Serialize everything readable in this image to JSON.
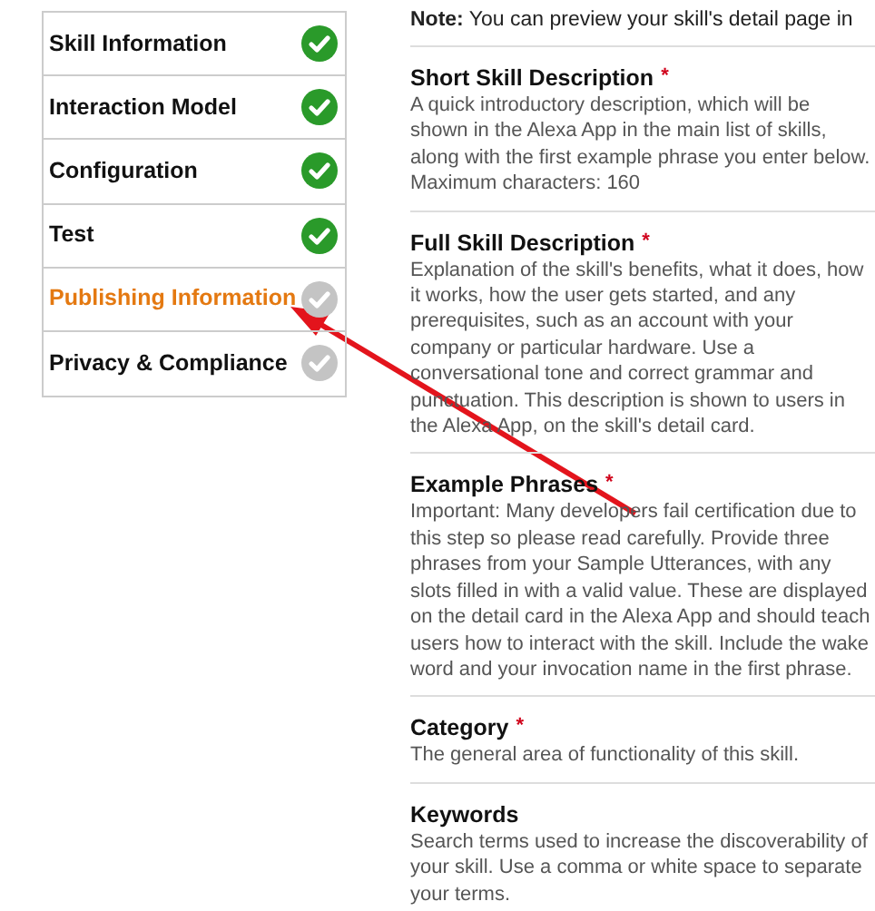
{
  "steps": [
    {
      "label": "Skill Information",
      "complete": true,
      "selected": false
    },
    {
      "label": "Interaction Model",
      "complete": true,
      "selected": false
    },
    {
      "label": "Configuration",
      "complete": true,
      "selected": false
    },
    {
      "label": "Test",
      "complete": true,
      "selected": false
    },
    {
      "label": "Publishing Information",
      "complete": false,
      "selected": true
    },
    {
      "label": "Privacy & Compliance",
      "complete": false,
      "selected": false
    }
  ],
  "note": "**Note:** You can preview your skill's detail page in",
  "fields": [
    {
      "title": "Short Skill Description",
      "required_mark": "*",
      "description": "A quick introductory description, which will be shown in the Alexa App in the main list of skills, along with the first example phrase you enter below. Maximum characters: 160"
    },
    {
      "title": "Full Skill Description",
      "required_mark": "*",
      "description": "Explanation of the skill's benefits, what it does, how it works, how the user gets started, and any prerequisites, such as an account with your company or particular hardware. Use a conversational tone and correct grammar and punctuation. This description is shown to users in the Alexa App, on the skill's detail card."
    },
    {
      "title": "Example Phrases",
      "required_mark": "*",
      "description": "Important: Many developers fail certification due to this step so please read carefully. Provide three phrases from your Sample Utterances, with any slots filled in with a valid value. These are displayed on the detail card in the Alexa App and should teach users how to interact with the skill. Include the wake word and your invocation name in the first phrase."
    },
    {
      "title": "Category",
      "required_mark": "*",
      "description": "The general area of functionality of this skill."
    },
    {
      "title": "Keywords",
      "description": "Search terms used to increase the discoverability of your skill. Use a comma or white space to separate your terms."
    }
  ]
}
